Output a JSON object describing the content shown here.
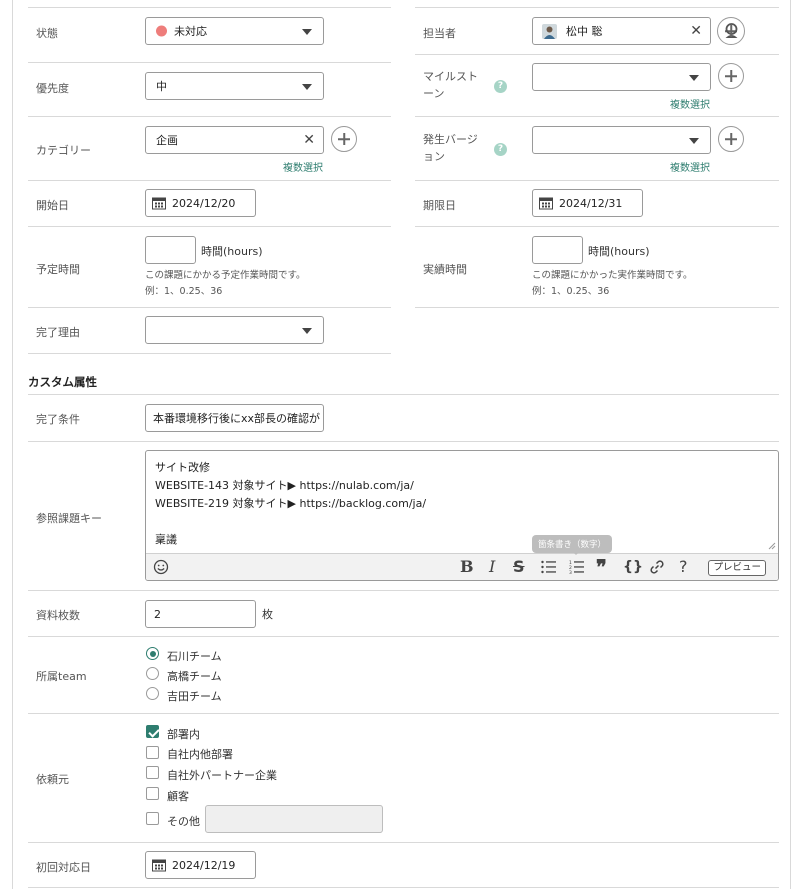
{
  "fields": {
    "status": {
      "label": "状態",
      "value": "未対応",
      "color": "#ee7d7b"
    },
    "assignee": {
      "label": "担当者",
      "value": "松中 聡"
    },
    "priority": {
      "label": "優先度",
      "value": "中"
    },
    "milestone": {
      "label": "マイルストーン",
      "multi": "複数選択"
    },
    "category": {
      "label": "カテゴリー",
      "value": "企画",
      "multi": "複数選択"
    },
    "version": {
      "label": "発生バージョン",
      "multi": "複数選択"
    },
    "start_date": {
      "label": "開始日",
      "value": "2024/12/20"
    },
    "due_date": {
      "label": "期限日",
      "value": "2024/12/31"
    },
    "estimated": {
      "label": "予定時間",
      "unit": "時間(hours)",
      "hint1": "この課題にかかる予定作業時間です。",
      "hint2": "例：1、0.25、36"
    },
    "actual": {
      "label": "実績時間",
      "unit": "時間(hours)",
      "hint1": "この課題にかかった実作業時間です。",
      "hint2": "例：1、0.25、36"
    },
    "resolution": {
      "label": "完了理由"
    }
  },
  "custom": {
    "title": "カスタム属性",
    "completion": {
      "label": "完了条件",
      "value": "本番環境移行後にxx部長の確認が"
    },
    "ref_keys": {
      "label": "参照課題キー",
      "lines": [
        "サイト改修",
        "WEBSITE-143  対象サイト▶ https://nulab.com/ja/",
        "WEBSITE-219 対象サイト▶ https://backlog.com/ja/",
        "",
        "稟議"
      ],
      "tooltip": "箇条書き（数字）",
      "preview": "プレビュー"
    },
    "pages": {
      "label": "資料枚数",
      "value": "2",
      "unit": "枚"
    },
    "team": {
      "label": "所属team",
      "options": [
        "石川チーム",
        "高橋チーム",
        "吉田チーム"
      ],
      "selected": 0
    },
    "requester": {
      "label": "依頼元",
      "options": [
        "部署内",
        "自社内他部署",
        "自社外パートナー企業",
        "顧客",
        "その他"
      ],
      "checked": [
        0
      ]
    },
    "first_response": {
      "label": "初回対応日",
      "value": "2024/12/19"
    }
  }
}
